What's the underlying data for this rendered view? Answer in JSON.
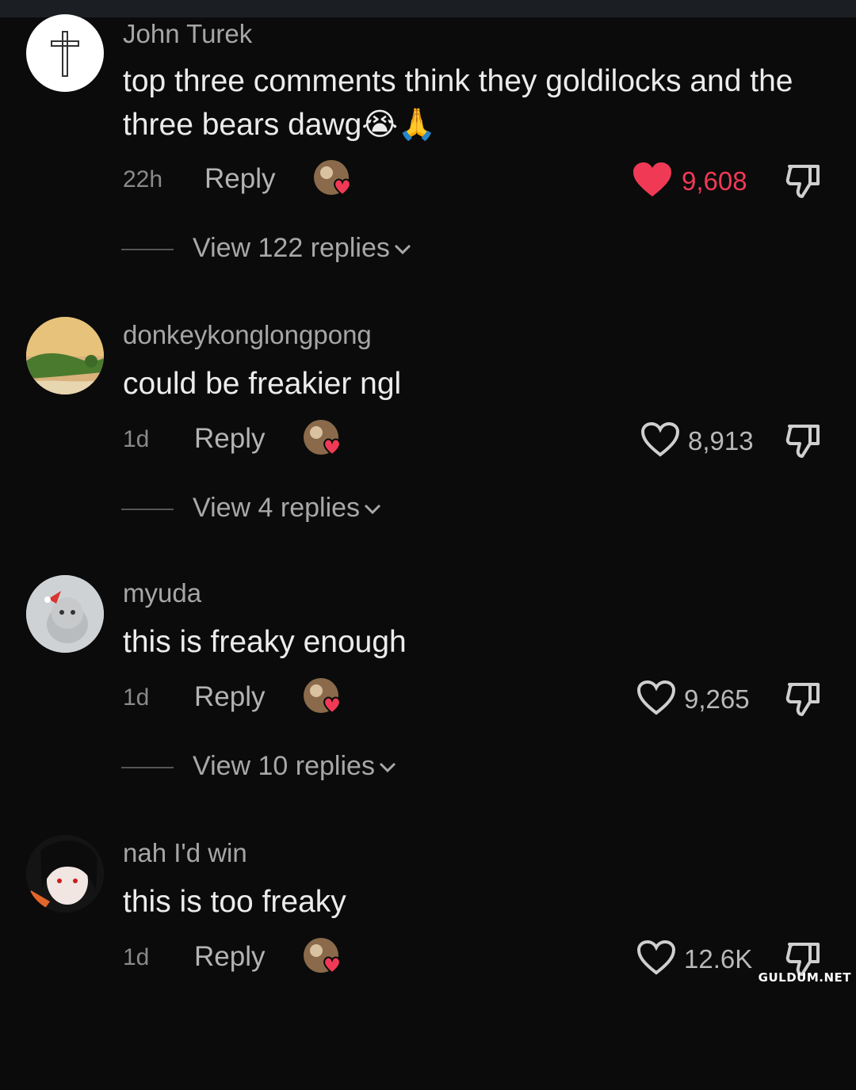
{
  "comments": [
    {
      "username": "John Turek",
      "text": "top three comments think they goldilocks and the three bears dawg😭🙏",
      "time": "22h",
      "reply_label": "Reply",
      "likes": "9,608",
      "liked": true,
      "view_replies": "View 122 replies",
      "avatar_icon": "cross-icon"
    },
    {
      "username": "donkeykonglongpong",
      "text": "could be freakier ngl",
      "time": "1d",
      "reply_label": "Reply",
      "likes": "8,913",
      "liked": false,
      "view_replies": "View 4 replies",
      "avatar_icon": "landscape-avatar"
    },
    {
      "username": "myuda",
      "text": "this is freaky enough",
      "time": "1d",
      "reply_label": "Reply",
      "likes": "9,265",
      "liked": false,
      "view_replies": "View 10 replies",
      "avatar_icon": "kitten-avatar"
    },
    {
      "username": "nah I'd win",
      "text": "this is too freaky",
      "time": "1d",
      "reply_label": "Reply",
      "likes": "12.6K",
      "liked": false,
      "avatar_icon": "anime-avatar"
    }
  ],
  "colors": {
    "background": "#0b0b0b",
    "like_red": "#f03a55",
    "text_primary": "#ececec",
    "text_secondary": "#a6a6a6"
  },
  "watermark": "GULDUM.NET"
}
